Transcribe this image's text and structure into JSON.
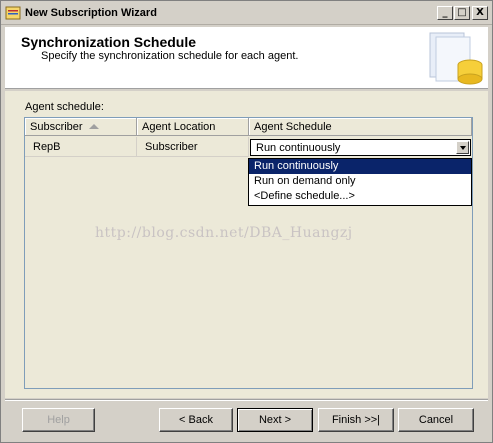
{
  "window": {
    "title": "New Subscription Wizard",
    "min_label": "_",
    "max_label": "□",
    "close_label": "X"
  },
  "header": {
    "title": "Synchronization Schedule",
    "subtitle": "Specify the synchronization schedule for each agent."
  },
  "section": {
    "label": "Agent schedule:"
  },
  "grid": {
    "columns": [
      "Subscriber",
      "Agent Location",
      "Agent Schedule"
    ],
    "sorted_column": "Subscriber",
    "rows": [
      {
        "subscriber": "RepB",
        "agent_location": "Subscriber",
        "agent_schedule": "Run continuously"
      }
    ]
  },
  "schedule_dropdown": {
    "options": [
      "Run continuously",
      "Run on demand only",
      "<Define schedule...>"
    ],
    "highlighted": "Run continuously"
  },
  "watermark": "http://blog.csdn.net/DBA_Huangzj",
  "buttons": {
    "help": "Help",
    "back": "< Back",
    "next": "Next >",
    "finish": "Finish >>|",
    "cancel": "Cancel"
  },
  "colors": {
    "selection": "#0a246a",
    "dialog": "#d4d0c8"
  }
}
